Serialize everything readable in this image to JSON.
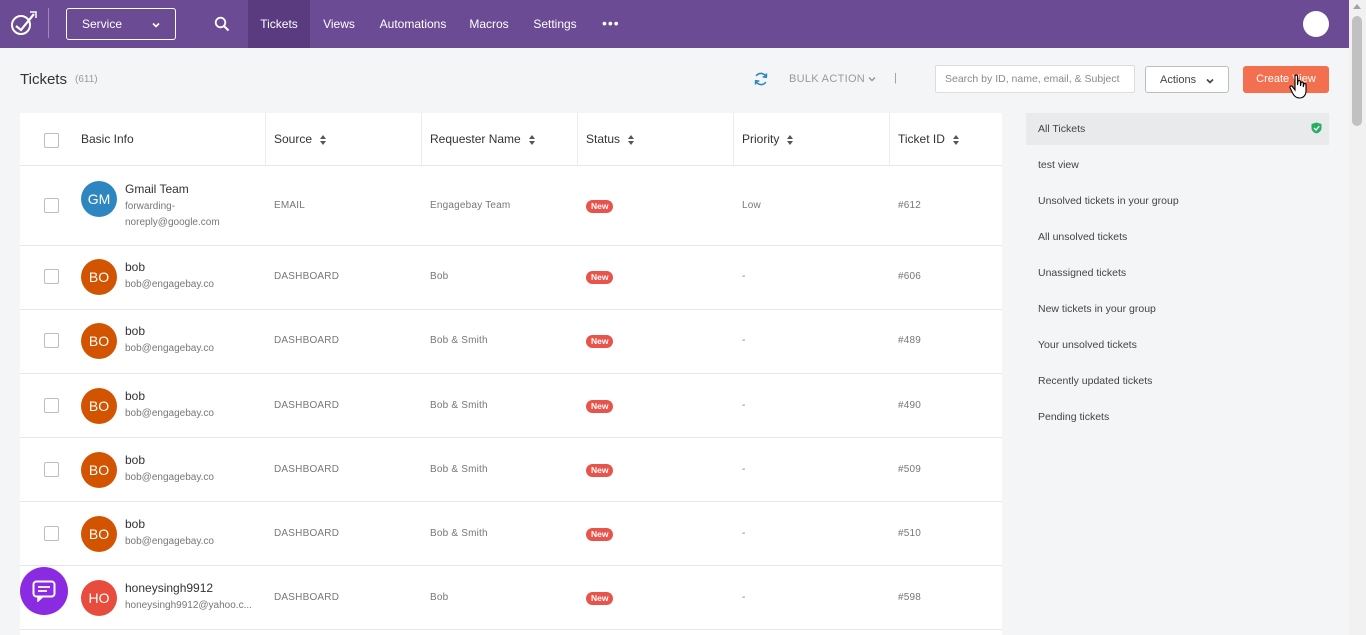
{
  "nav": {
    "service_label": "Service",
    "items": [
      {
        "label": "Tickets"
      },
      {
        "label": "Views"
      },
      {
        "label": "Automations"
      },
      {
        "label": "Macros"
      },
      {
        "label": "Settings"
      }
    ],
    "more_label": "•••"
  },
  "header": {
    "title": "Tickets",
    "count": "(611)",
    "bulk_action": "BULK ACTION",
    "separator": "|",
    "search_placeholder": "Search by ID, name, email, & Subject",
    "actions_label": "Actions",
    "create_label": "Create View"
  },
  "table": {
    "columns": [
      "Basic Info",
      "Source",
      "Requester Name",
      "Status",
      "Priority",
      "Ticket ID"
    ],
    "rows": [
      {
        "initials": "GM",
        "name": "Gmail Team",
        "email": "forwarding-noreply@google.com",
        "source": "EMAIL",
        "requester": "Engagebay Team",
        "status": "New",
        "priority": "Low",
        "id": "#612",
        "avatar_color": "#2e86c1"
      },
      {
        "initials": "BO",
        "name": "bob",
        "email": "bob@engagebay.co",
        "source": "DASHBOARD",
        "requester": "Bob",
        "status": "New",
        "priority": "-",
        "id": "#606",
        "avatar_color": "#d35400"
      },
      {
        "initials": "BO",
        "name": "bob",
        "email": "bob@engagebay.co",
        "source": "DASHBOARD",
        "requester": "Bob & Smith",
        "status": "New",
        "priority": "-",
        "id": "#489",
        "avatar_color": "#d35400"
      },
      {
        "initials": "BO",
        "name": "bob",
        "email": "bob@engagebay.co",
        "source": "DASHBOARD",
        "requester": "Bob & Smith",
        "status": "New",
        "priority": "-",
        "id": "#490",
        "avatar_color": "#d35400"
      },
      {
        "initials": "BO",
        "name": "bob",
        "email": "bob@engagebay.co",
        "source": "DASHBOARD",
        "requester": "Bob & Smith",
        "status": "New",
        "priority": "-",
        "id": "#509",
        "avatar_color": "#d35400"
      },
      {
        "initials": "BO",
        "name": "bob",
        "email": "bob@engagebay.co",
        "source": "DASHBOARD",
        "requester": "Bob & Smith",
        "status": "New",
        "priority": "-",
        "id": "#510",
        "avatar_color": "#d35400"
      },
      {
        "initials": "HO",
        "name": "honeysingh9912",
        "email": "honeysingh9912@yahoo.c...",
        "source": "DASHBOARD",
        "requester": "Bob",
        "status": "New",
        "priority": "-",
        "id": "#598",
        "avatar_color": "#e74c3c"
      }
    ]
  },
  "views": [
    {
      "label": "All Tickets"
    },
    {
      "label": "test view"
    },
    {
      "label": "Unsolved tickets in your group"
    },
    {
      "label": "All unsolved tickets"
    },
    {
      "label": "Unassigned tickets"
    },
    {
      "label": "New tickets in your group"
    },
    {
      "label": "Your unsolved tickets"
    },
    {
      "label": "Recently updated tickets"
    },
    {
      "label": "Pending tickets"
    }
  ],
  "colors": {
    "nav_bg": "#6b4b94",
    "nav_active": "#5a3b80",
    "accent": "#f2704f",
    "badge": "#e8534b",
    "chat": "#8a2be2",
    "refresh": "#2e86c1",
    "shield": "#27ae60"
  },
  "icons": [
    "logo-icon",
    "chevron-down-icon",
    "search-icon",
    "more-icon",
    "refresh-icon",
    "sort-icon",
    "shield-check-icon",
    "chat-icon",
    "cursor-hand-icon"
  ]
}
